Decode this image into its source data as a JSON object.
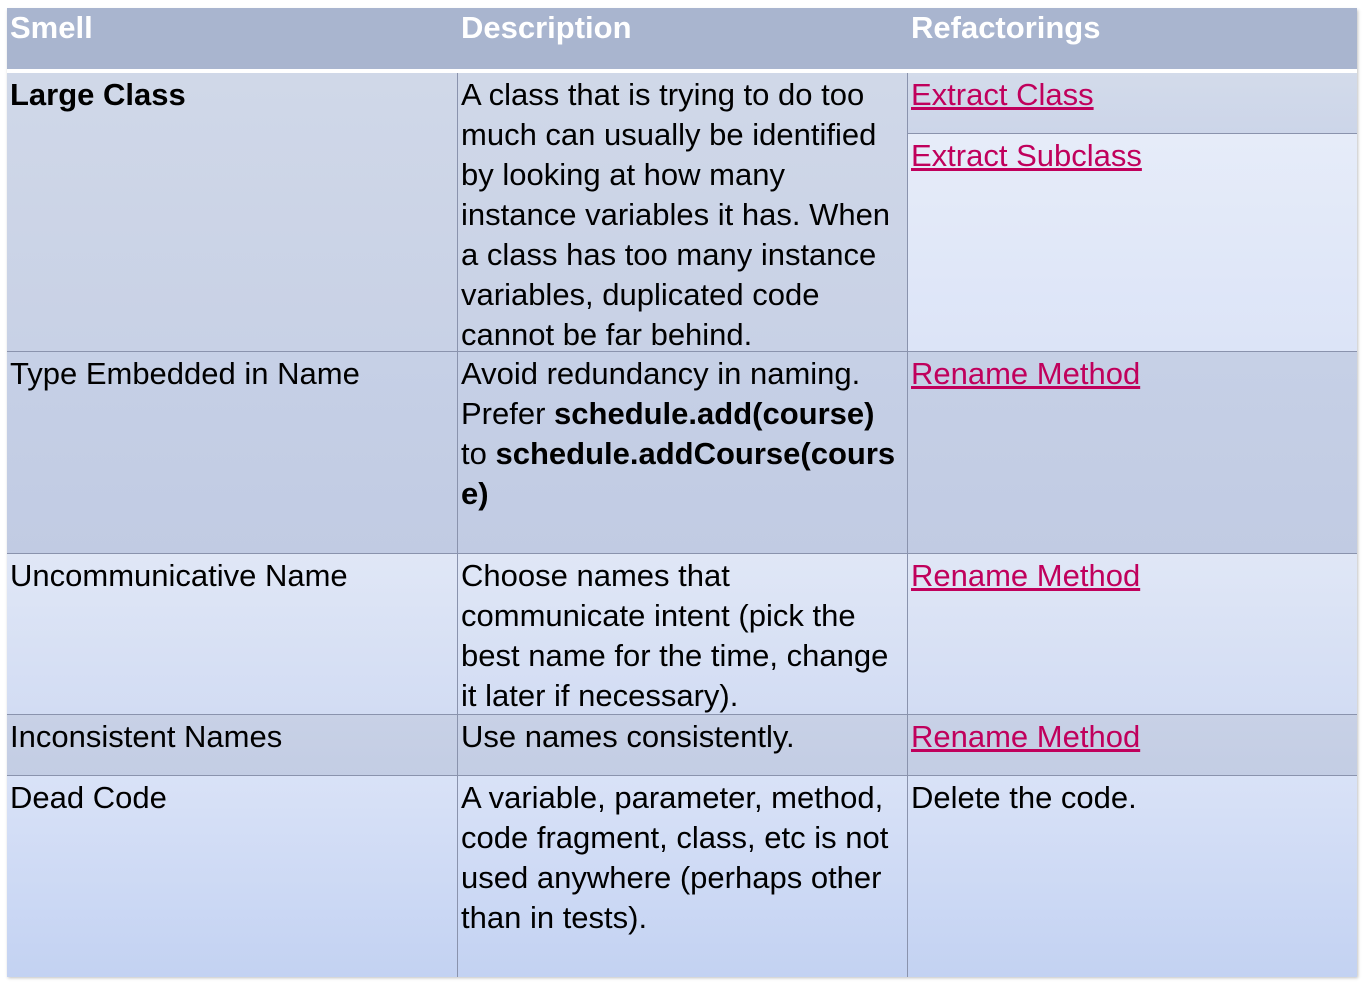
{
  "header": {
    "smell": "Smell",
    "description": "Description",
    "refactorings": "Refactorings"
  },
  "rows": [
    {
      "smell": "Large Class",
      "description": "A class that is trying to do too much can usually be identified by looking at how many instance variables it has. When a class has too many instance variables, duplicated code cannot be far behind.",
      "refactorings": [
        "Extract Class",
        "Extract Subclass"
      ]
    },
    {
      "smell": "Type Embedded in Name",
      "description_parts": {
        "text1": "Avoid redundancy in naming. Prefer ",
        "code1": "schedule.add(course)",
        "text2": " to ",
        "code2": "schedule.addCourse(course)"
      },
      "refactorings": [
        "Rename Method"
      ]
    },
    {
      "smell": "Uncommunicative Name",
      "description": "Choose names that communicate intent (pick the best name for the time, change it later if necessary).",
      "refactorings": [
        "Rename Method"
      ]
    },
    {
      "smell": "Inconsistent Names",
      "description": "Use names consistently.",
      "refactorings": [
        "Rename Method"
      ]
    },
    {
      "smell": "Dead Code",
      "description": "A variable, parameter, method, code fragment, class, etc is not used anywhere (perhaps other than in tests).",
      "refactorings_text": "Delete the code."
    }
  ],
  "colors": {
    "header_bg": "#a9b5cf",
    "link": "#c0005c",
    "row_dark": "#c8d1e6",
    "row_light": "#dce4f7"
  }
}
